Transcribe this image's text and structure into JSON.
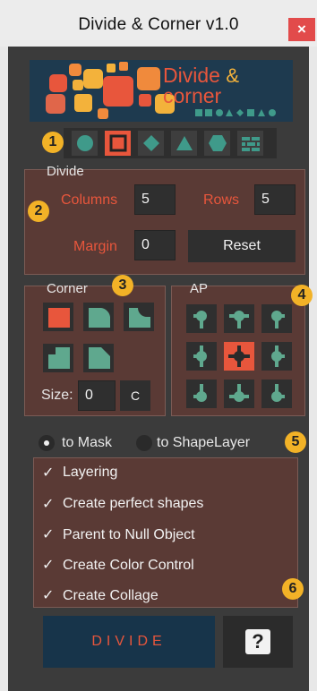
{
  "window": {
    "title": "Divide & Corner v1.0",
    "close_label": "×"
  },
  "logo": {
    "word1": "Divide",
    "amp": "&",
    "word2": "corner"
  },
  "toolbar": {
    "tools": [
      "circle",
      "square",
      "diamond",
      "triangle",
      "hexagon",
      "brick"
    ],
    "active_index": 1
  },
  "badges": [
    "1",
    "2",
    "3",
    "4",
    "5",
    "6"
  ],
  "divide": {
    "title": "Divide",
    "columns_label": "Columns",
    "columns_value": "5",
    "rows_label": "Rows",
    "rows_value": "5",
    "margin_label": "Margin",
    "margin_value": "0",
    "reset_label": "Reset"
  },
  "corner": {
    "title": "Corner",
    "size_label": "Size:",
    "size_value": "0",
    "c_label": "C"
  },
  "ap": {
    "title": "AP",
    "active_index": 4
  },
  "output": {
    "to_mask_label": "to Mask",
    "to_shapelayer_label": "to ShapeLayer",
    "selected": "to Mask"
  },
  "options": [
    {
      "label": "Layering",
      "checked": true
    },
    {
      "label": "Create perfect shapes",
      "checked": true
    },
    {
      "label": "Parent to Null Object",
      "checked": true
    },
    {
      "label": "Create Color Control",
      "checked": true
    },
    {
      "label": "Create Collage",
      "checked": true
    }
  ],
  "check_glyph": "✓",
  "actions": {
    "divide_label": "DIVIDE",
    "help_label": "?"
  },
  "colors": {
    "accent": "#e8563c",
    "badge": "#f2b227",
    "banner": "#1e3a4f",
    "section": "#5a3a35"
  }
}
